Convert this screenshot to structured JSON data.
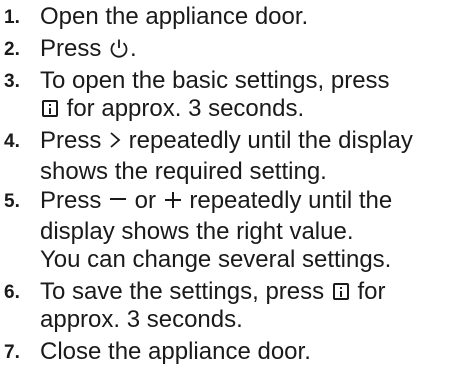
{
  "instructions": {
    "steps": [
      {
        "num": "1.",
        "text": "Open the appliance door."
      },
      {
        "num": "2.",
        "before": "Press ",
        "icon": "power-icon",
        "after": "."
      },
      {
        "num": "3.",
        "line1": "To open the basic settings, press",
        "icon": "info-icon",
        "line2_after": " for approx. 3 seconds."
      },
      {
        "num": "4.",
        "before": "Press ",
        "icon": "chevron-right-icon",
        "line1_after": " repeatedly until the display",
        "line2": "shows the required setting."
      },
      {
        "num": "5.",
        "before": "Press ",
        "icon1": "minus-icon",
        "mid": " or ",
        "icon2": "plus-icon",
        "line1_after": " repeatedly until the",
        "line2": "display shows the right value."
      },
      {
        "num": "6.",
        "before": "To save the settings, press ",
        "icon": "info-icon",
        "line1_after": " for",
        "line2": "approx. 3 seconds."
      },
      {
        "num": "7.",
        "text": "Close the appliance door."
      }
    ],
    "note": "You can change several settings."
  }
}
